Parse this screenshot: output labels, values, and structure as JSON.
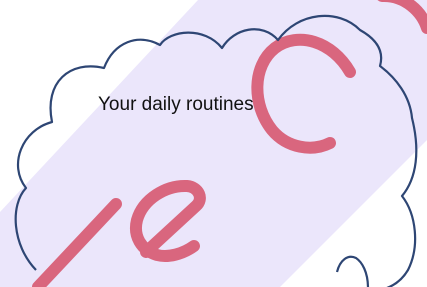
{
  "document": {
    "cloud_caption": "Your daily routines",
    "cloud_outline_color": "#2e4674",
    "watermark_color": "#d9667e",
    "highlight_band_color": "#ebe6fb"
  }
}
